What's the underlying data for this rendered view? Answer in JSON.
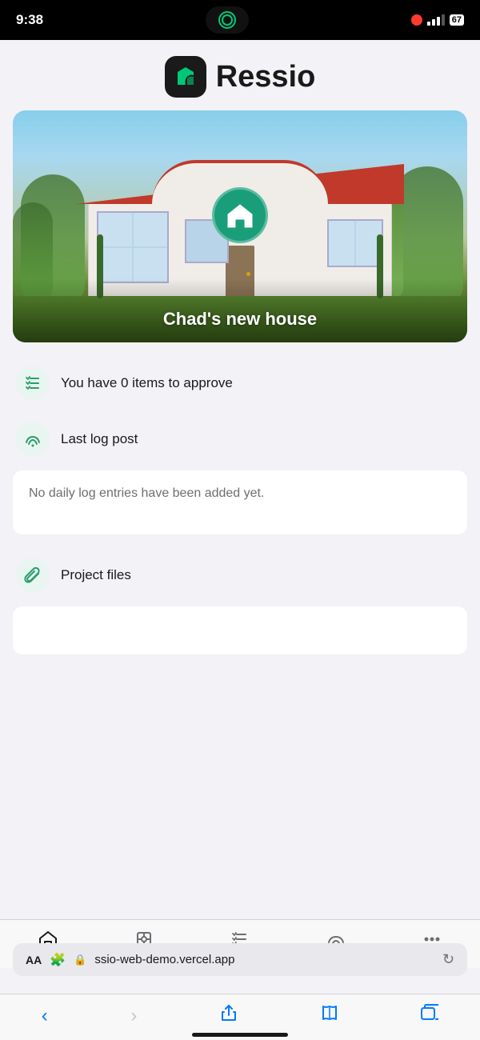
{
  "statusBar": {
    "time": "9:38",
    "battery": "67"
  },
  "header": {
    "appName": "Ressio"
  },
  "hero": {
    "title": "Chad's new house"
  },
  "approvals": {
    "text": "You have 0 items to approve"
  },
  "logSection": {
    "label": "Last log post",
    "emptyMessage": "No daily log entries have been added yet."
  },
  "filesSection": {
    "label": "Project files"
  },
  "nav": {
    "items": [
      {
        "id": "home",
        "label": "Home",
        "active": true
      },
      {
        "id": "specs",
        "label": "Specs",
        "active": false
      },
      {
        "id": "approvals",
        "label": "Approvals",
        "active": false
      },
      {
        "id": "log",
        "label": "Log",
        "active": false
      },
      {
        "id": "more",
        "label": "More",
        "active": false
      }
    ]
  },
  "browser": {
    "aa": "AA",
    "url": "ssio-web-demo.vercel.app"
  }
}
